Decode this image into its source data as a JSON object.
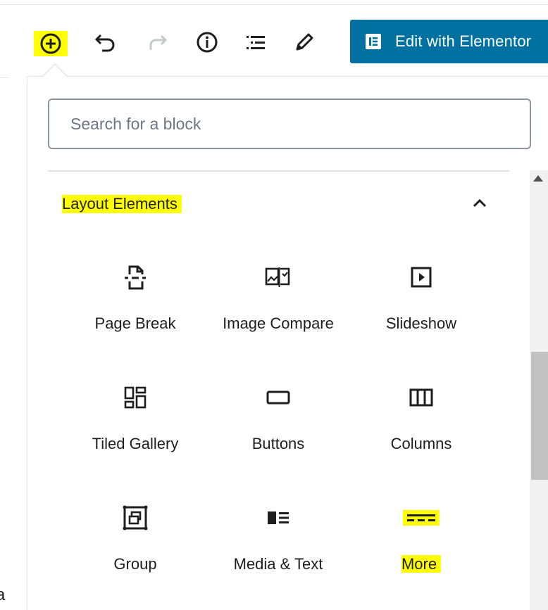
{
  "toolbar": {
    "add_label": "Add block",
    "undo_label": "Undo",
    "redo_label": "Redo",
    "info_label": "Content structure",
    "outline_label": "Block navigation",
    "edit_label": "Tools",
    "elementor_label": "Edit with Elementor"
  },
  "search": {
    "placeholder": "Search for a block"
  },
  "section": {
    "title": "Layout Elements"
  },
  "blocks": [
    {
      "label": "Page Break",
      "icon": "page-break-icon"
    },
    {
      "label": "Image Compare",
      "icon": "image-compare-icon"
    },
    {
      "label": "Slideshow",
      "icon": "slideshow-icon"
    },
    {
      "label": "Tiled Gallery",
      "icon": "tiled-gallery-icon"
    },
    {
      "label": "Buttons",
      "icon": "buttons-icon"
    },
    {
      "label": "Columns",
      "icon": "columns-icon"
    },
    {
      "label": "Group",
      "icon": "group-icon"
    },
    {
      "label": "Media & Text",
      "icon": "media-text-icon"
    },
    {
      "label": "More",
      "icon": "more-icon"
    }
  ],
  "colors": {
    "highlight": "#ffff00",
    "elementor_blue": "#0071a1",
    "text": "#1e1e1e",
    "disabled": "#c6c9cc"
  },
  "left_edge_char": "a"
}
